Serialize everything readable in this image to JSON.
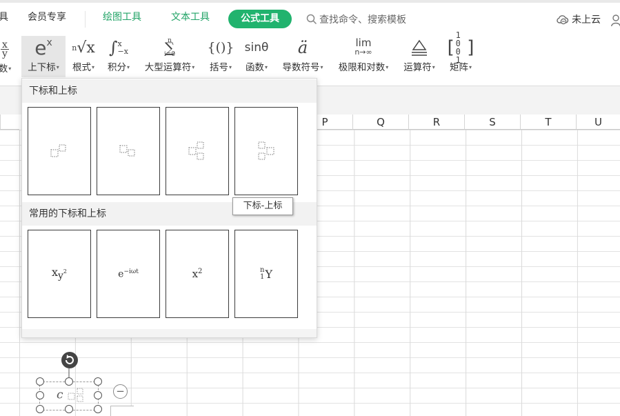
{
  "menu": {
    "partial_left": "具",
    "member": "会员专享",
    "draw_tools": "绘图工具",
    "text_tools": "文本工具",
    "formula_tools": "公式工具",
    "search_placeholder": "查找命令、搜索模板",
    "cloud_status": "未上云"
  },
  "ribbon": {
    "tools": [
      {
        "label": "数",
        "glyph": "x/y"
      },
      {
        "label": "上下标",
        "glyph": "eˣ"
      },
      {
        "label": "根式",
        "glyph": "ⁿ√x"
      },
      {
        "label": "积分",
        "glyph": "∫"
      },
      {
        "label": "大型运算符",
        "glyph": "∑"
      },
      {
        "label": "括号",
        "glyph": "{()}"
      },
      {
        "label": "函数",
        "glyph": "sinθ"
      },
      {
        "label": "导数符号",
        "glyph": "ä"
      },
      {
        "label": "极限和对数",
        "glyph": "lim n→∞"
      },
      {
        "label": "运算符",
        "glyph": "≜"
      },
      {
        "label": "矩阵",
        "glyph": "[10 01]"
      }
    ]
  },
  "columns": [
    "P",
    "Q",
    "R",
    "S",
    "T",
    "U"
  ],
  "panel": {
    "section1_title": "下标和上标",
    "section2_title": "常用的下标和上标",
    "common": [
      {
        "base": "x",
        "sub": "y",
        "sup": "2"
      },
      {
        "base": "e",
        "sup": "−iωt"
      },
      {
        "base": "x",
        "sup": "2"
      },
      {
        "base": "Y",
        "presup": "n",
        "presub": "1"
      }
    ],
    "tooltip": "下标-上标"
  },
  "object": {
    "text": "c"
  }
}
